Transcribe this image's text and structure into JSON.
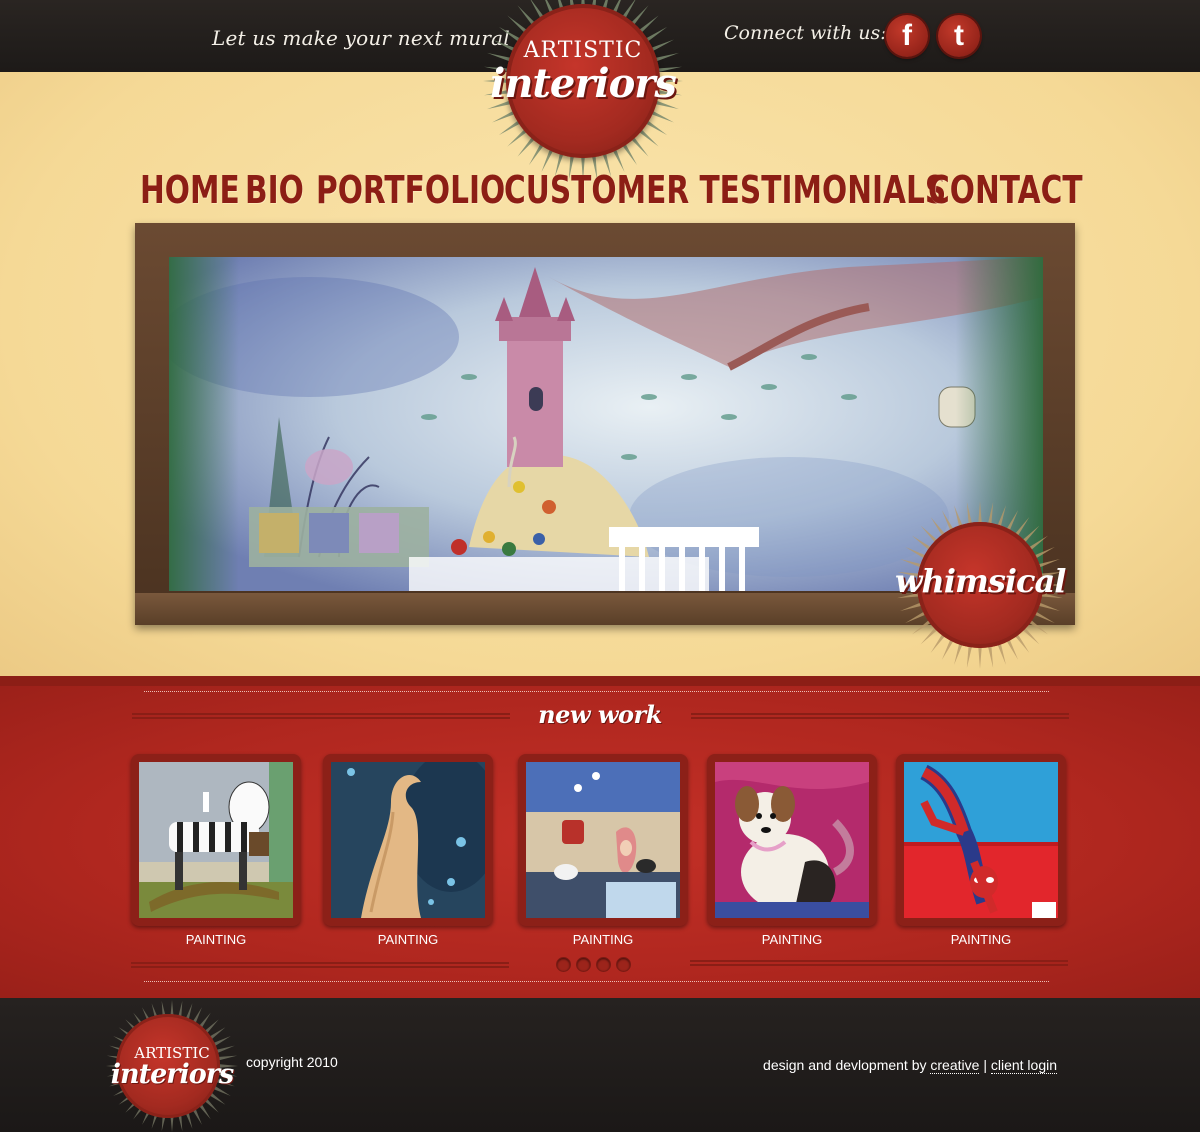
{
  "header": {
    "tagline": "Let us make your next mural",
    "connect_label": "Connect with us:",
    "social": [
      {
        "name": "facebook-icon",
        "glyph": "f"
      },
      {
        "name": "twitter-icon",
        "glyph": "t"
      }
    ]
  },
  "logo": {
    "line1": "ARTISTIC",
    "line2": "interiors"
  },
  "nav": [
    "HOME",
    "BIO",
    "PORTFOLIO",
    "CUSTOMER TESTIMONIALS",
    "CONTACT"
  ],
  "feature": {
    "badge": "whimsical"
  },
  "new_work": {
    "heading": "new work",
    "items": [
      {
        "caption": "PAINTING"
      },
      {
        "caption": "PAINTING"
      },
      {
        "caption": "PAINTING"
      },
      {
        "caption": "PAINTING"
      },
      {
        "caption": "PAINTING"
      }
    ],
    "page_count": 4
  },
  "footer": {
    "logo_line1": "ARTISTIC",
    "logo_line2": "interiors",
    "copyright": "copyright 2010",
    "credit_prefix": "design and devlopment by",
    "credit_link": "creative",
    "separator": "|",
    "login_link": "client login"
  },
  "colors": {
    "brand_red": "#a32a20",
    "nav_red": "#8c1e15",
    "cream": "#f7dc9c",
    "dark": "#1d1a18"
  }
}
